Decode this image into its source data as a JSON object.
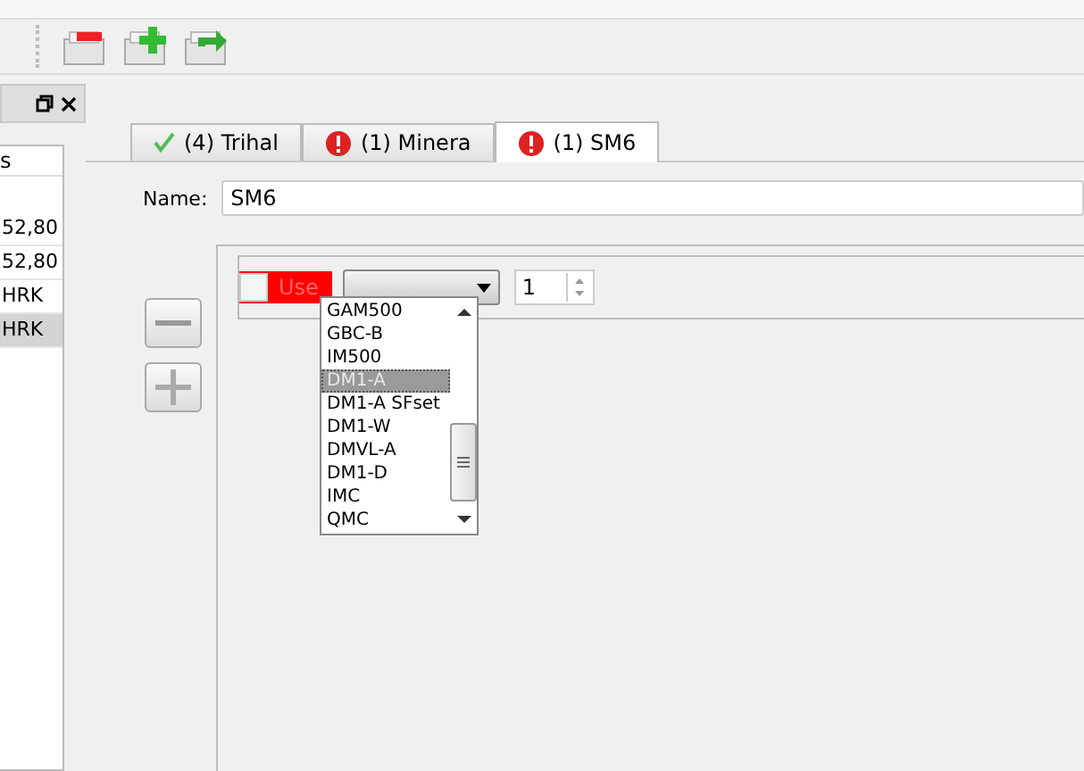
{
  "toolbar": {
    "buttons": [
      {
        "kind": "remove"
      },
      {
        "kind": "add"
      },
      {
        "kind": "forward"
      }
    ]
  },
  "side_panel": {
    "list_header": "s",
    "rows": [
      {
        "text": "52,80",
        "selected": false
      },
      {
        "text": "52,80",
        "selected": false
      },
      {
        "text": "HRK",
        "selected": false
      },
      {
        "text": "HRK",
        "selected": true
      }
    ]
  },
  "tabs": [
    {
      "label": "(4) Trihal",
      "kind": "ok",
      "selected": false
    },
    {
      "label": "(1) Minera",
      "kind": "error",
      "selected": false
    },
    {
      "label": "(1) SM6",
      "kind": "error",
      "selected": true
    }
  ],
  "name": {
    "label": "Name:",
    "value": "SM6"
  },
  "row": {
    "use_label": "Use",
    "use_checked": false,
    "quantity": "1"
  },
  "dropdown": {
    "items": [
      {
        "label": "GAM500",
        "selected": false
      },
      {
        "label": "GBC-B",
        "selected": false
      },
      {
        "label": "IM500",
        "selected": false
      },
      {
        "label": "DM1-A",
        "selected": true
      },
      {
        "label": "DM1-A SFset",
        "selected": false
      },
      {
        "label": "DM1-W",
        "selected": false
      },
      {
        "label": "DMVL-A",
        "selected": false
      },
      {
        "label": "DM1-D",
        "selected": false
      },
      {
        "label": "IMC",
        "selected": false
      },
      {
        "label": "QMC",
        "selected": false
      }
    ]
  }
}
